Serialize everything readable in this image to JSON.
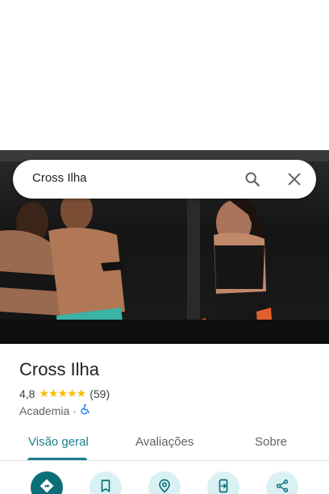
{
  "search": {
    "query": "Cross Ilha"
  },
  "place": {
    "name": "Cross Ilha",
    "rating": "4,8",
    "stars": "★★★★★",
    "review_count": "(59)",
    "category": "Academia",
    "separator": "·"
  },
  "tabs": [
    {
      "label": "Visão geral",
      "active": true
    },
    {
      "label": "Avaliações",
      "active": false
    },
    {
      "label": "Sobre",
      "active": false
    }
  ],
  "actions": [
    {
      "icon": "directions-icon"
    },
    {
      "icon": "bookmark-icon"
    },
    {
      "icon": "location-pin-icon"
    },
    {
      "icon": "send-to-phone-icon"
    },
    {
      "icon": "share-icon"
    }
  ],
  "colors": {
    "accent": "#1a7f8c",
    "primary_action": "#0b6f78",
    "action_bg": "#d9f1f3",
    "star": "#fbbc04"
  }
}
